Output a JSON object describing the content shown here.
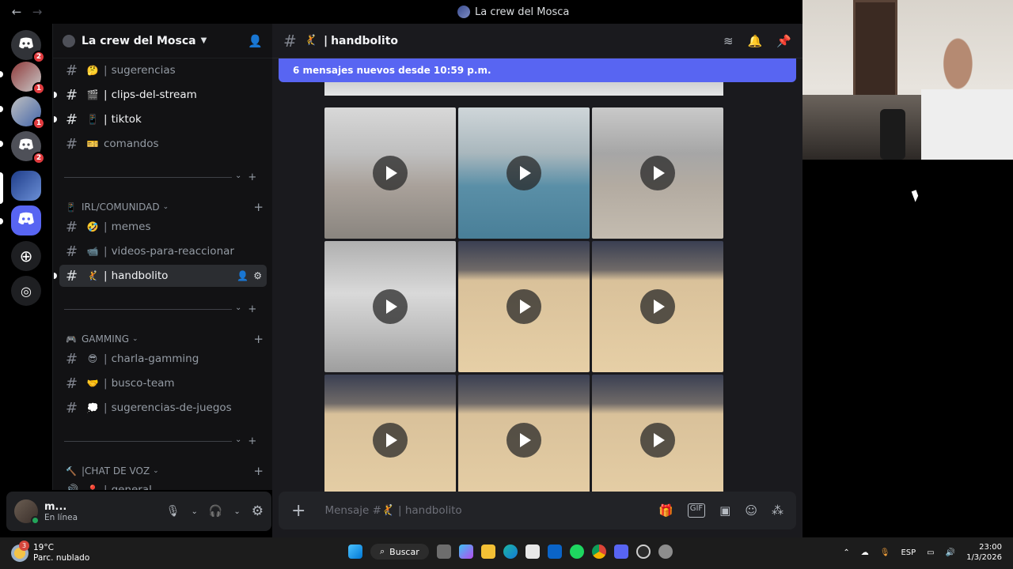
{
  "window": {
    "title": "La crew del Mosca",
    "back": "←",
    "forward": "→"
  },
  "rail": {
    "badges": [
      "2",
      "1",
      "1",
      "2"
    ]
  },
  "server": {
    "name": "La crew del Mosca"
  },
  "channels_top": [
    {
      "name": "sugerencias",
      "emoji": "🤔",
      "state": "muted"
    },
    {
      "name": "clips-del-stream",
      "emoji": "🎬",
      "state": "unread"
    },
    {
      "name": "tiktok",
      "emoji": "📱",
      "state": "unread"
    },
    {
      "name": "comandos",
      "emoji": "🎫",
      "state": "muted"
    }
  ],
  "categories": {
    "irl": "IRL/COMUNIDAD",
    "gaming": "GAMMING",
    "voice": "CHAT DE VOZ"
  },
  "channels_irl": [
    {
      "name": "memes",
      "emoji": "🤣",
      "state": "muted"
    },
    {
      "name": "videos-para-reaccionar",
      "emoji": "📹",
      "state": "muted"
    },
    {
      "name": "handbolito",
      "emoji": "🤾",
      "state": "active"
    }
  ],
  "channels_gaming": [
    {
      "name": "charla-gamming",
      "emoji": "😎",
      "state": "muted"
    },
    {
      "name": "busco-team",
      "emoji": "🤝",
      "state": "muted"
    },
    {
      "name": "sugerencias-de-juegos",
      "emoji": "💭",
      "state": "muted"
    }
  ],
  "voice_partial": "general",
  "user": {
    "name": "m...",
    "status": "En línea"
  },
  "channel": {
    "name": "handbolito",
    "prefix": "|"
  },
  "new_messages": "6 mensajes nuevos desde 10:59 p.m.",
  "videos": [
    {
      "label": "video 1"
    },
    {
      "label": "video 2"
    },
    {
      "label": "video 3"
    },
    {
      "label": "video 4"
    },
    {
      "label": "video 5"
    },
    {
      "label": "video 6"
    },
    {
      "label": "video 7"
    },
    {
      "label": "video 8"
    },
    {
      "label": "video 9"
    }
  ],
  "composer": {
    "placeholder": "Mensaje #🤾 | handbolito"
  },
  "taskbar": {
    "temp": "19°C",
    "weather": "Parc. nublado",
    "weather_badge": "3",
    "search": "Buscar",
    "lang": "ESP",
    "time": "23:00",
    "date": "1/3/2026"
  }
}
